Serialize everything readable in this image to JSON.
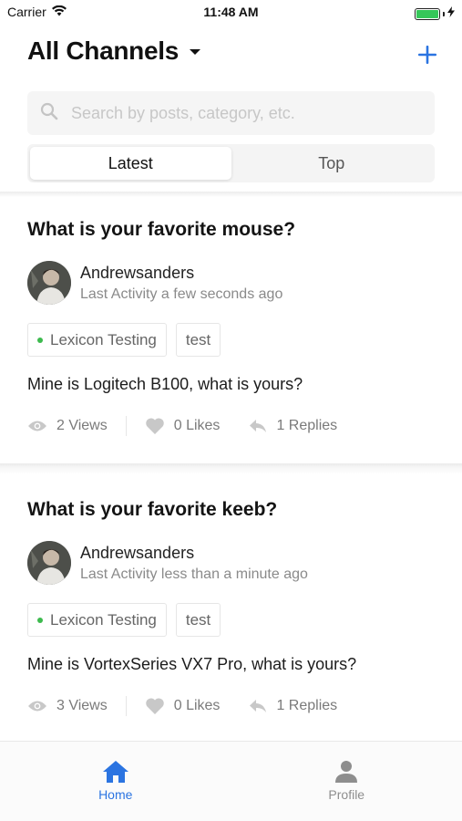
{
  "status_bar": {
    "carrier": "Carrier",
    "time": "11:48 AM",
    "battery_level": 1.0,
    "battery_color": "#35c759"
  },
  "header": {
    "title": "All Channels",
    "dropdown_icon": "caret-down-icon",
    "add_icon": "plus-icon",
    "accent_color": "#2b74e1"
  },
  "search": {
    "placeholder": "Search by posts, category, etc.",
    "icon": "search-icon"
  },
  "tabs": [
    {
      "label": "Latest",
      "active": true
    },
    {
      "label": "Top",
      "active": false
    }
  ],
  "posts": [
    {
      "title": "What is your favorite mouse?",
      "author": "Andrewsanders",
      "activity": "Last Activity a few seconds ago",
      "tags": [
        {
          "label": "Lexicon Testing",
          "dot_color": "#3dba4e"
        },
        {
          "label": "test"
        }
      ],
      "body": "Mine is Logitech B100, what is yours?",
      "views": "2 Views",
      "likes": "0 Likes",
      "replies": "1 Replies"
    },
    {
      "title": "What is your favorite keeb?",
      "author": "Andrewsanders",
      "activity": "Last Activity less than a minute ago",
      "tags": [
        {
          "label": "Lexicon Testing",
          "dot_color": "#3dba4e"
        },
        {
          "label": "test"
        }
      ],
      "body": "Mine is VortexSeries VX7 Pro, what is yours?",
      "views": "3 Views",
      "likes": "0 Likes",
      "replies": "1 Replies"
    }
  ],
  "tab_bar": [
    {
      "label": "Home",
      "icon": "home-icon",
      "active": true
    },
    {
      "label": "Profile",
      "icon": "profile-icon",
      "active": false
    }
  ]
}
